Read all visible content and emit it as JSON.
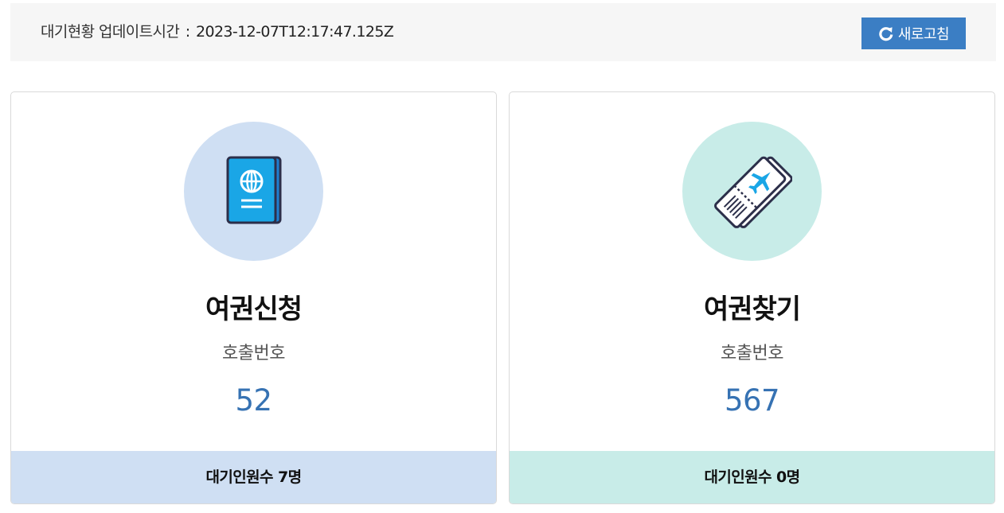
{
  "header": {
    "status_label": "대기현황 업데이트시간",
    "separator": ":",
    "updated_at": "2023-12-07T12:17:47.125Z",
    "refresh_label": "새로고침",
    "refresh_icon": "refresh-icon"
  },
  "cards": [
    {
      "icon": "passport-icon",
      "title": "여권신청",
      "sub_label": "호출번호",
      "call_number": "52",
      "waiting_text": "대기인원수 7명",
      "color": "#cfdff3"
    },
    {
      "icon": "ticket-icon",
      "title": "여권찾기",
      "sub_label": "호출번호",
      "call_number": "567",
      "waiting_text": "대기인원수 0명",
      "color": "#c8ece8"
    }
  ],
  "colors": {
    "accent": "#3b7ec4",
    "number": "#3672b3",
    "topbar_bg": "#f6f6f6"
  }
}
